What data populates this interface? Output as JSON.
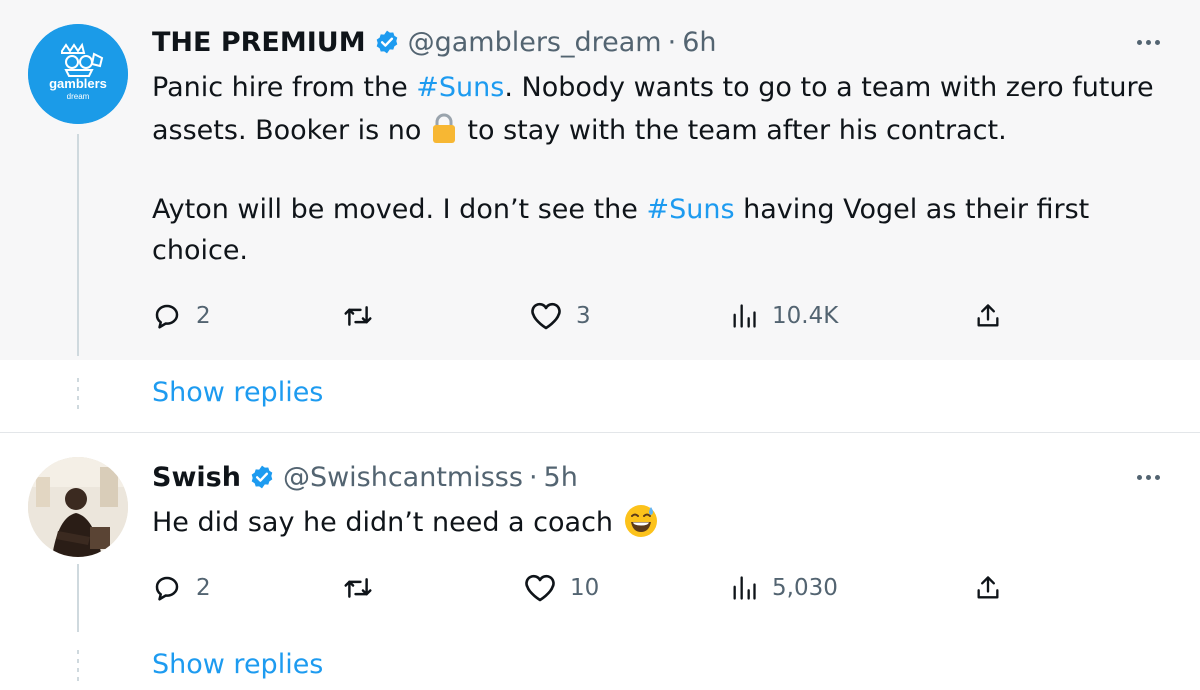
{
  "tweet1": {
    "name": "THE PREMIUM",
    "handle": "@gamblers_dream",
    "separator": "·",
    "time": "6h",
    "avatar_text": "gamblers",
    "avatar_subtext": "dream",
    "text_line1_a": "Panic hire from the ",
    "hashtag1": "#Suns",
    "text_line1_b": ". Nobody wants to go to a team with zero future",
    "text_line2_a": "assets. Booker is no",
    "lock_icon": "lock-icon",
    "text_line2_b": "to stay with the team after his contract.",
    "text_line3_a": "Ayton will be moved. I don’t see the ",
    "hashtag2": "#Suns",
    "text_line3_b": " having Vogel as their first",
    "text_line4": "choice.",
    "replies": "2",
    "likes": "3",
    "views": "10.4K",
    "show_replies": "Show replies"
  },
  "tweet2": {
    "name": "Swish",
    "handle": "@Swishcantmisss",
    "separator": "·",
    "time": "5h",
    "text": "He did say he didn’t need a coach",
    "emoji": "grinning-sweat-emoji",
    "replies": "2",
    "likes": "10",
    "views": "5,030",
    "show_replies": "Show replies"
  },
  "colors": {
    "link": "#1d9bf0",
    "verified": "#1d9bf0",
    "secondary_text": "#536471",
    "avatar_blue": "#1b9be8"
  }
}
